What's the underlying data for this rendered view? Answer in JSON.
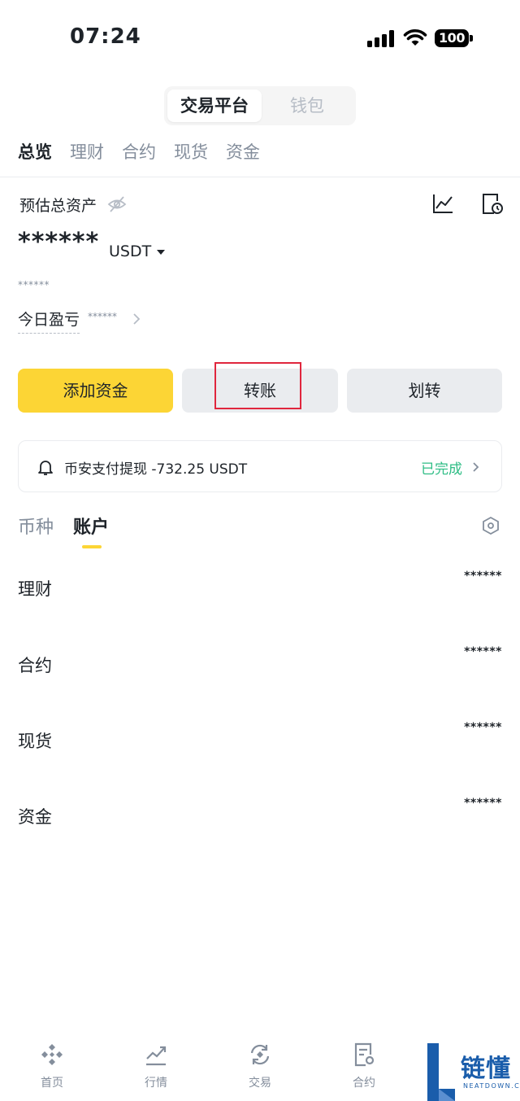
{
  "status_bar": {
    "time": "07:24",
    "battery": "100"
  },
  "segment": {
    "active": "交易平台",
    "inactive": "钱包"
  },
  "tabs": [
    "总览",
    "理财",
    "合约",
    "现货",
    "资金"
  ],
  "overview": {
    "estimated_label": "预估总资产",
    "masked_total": "******",
    "unit": "USDT",
    "masked_small": "******",
    "today_pnl_label": "今日盈亏",
    "today_pnl_value": "******"
  },
  "actions": {
    "add_funds": "添加资金",
    "transfer": "转账",
    "move": "划转"
  },
  "notice": {
    "text": "币安支付提现 -732.25 USDT",
    "status": "已完成"
  },
  "sub_tabs": {
    "coin": "币种",
    "account": "账户"
  },
  "accounts": [
    {
      "label": "理财",
      "value": "******"
    },
    {
      "label": "合约",
      "value": "******"
    },
    {
      "label": "现货",
      "value": "******"
    },
    {
      "label": "资金",
      "value": "******"
    }
  ],
  "bottom_nav": [
    {
      "label": "首页",
      "icon": "home-icon"
    },
    {
      "label": "行情",
      "icon": "markets-icon"
    },
    {
      "label": "交易",
      "icon": "trade-icon"
    },
    {
      "label": "合约",
      "icon": "futures-icon"
    }
  ],
  "watermark": {
    "text": "链懂",
    "sub": "NEATDOWN.COM"
  },
  "colors": {
    "accent": "#fcd535",
    "success": "#2ebd85",
    "highlight": "#e0263d",
    "text": "#1e2329",
    "muted": "#848e9c"
  }
}
